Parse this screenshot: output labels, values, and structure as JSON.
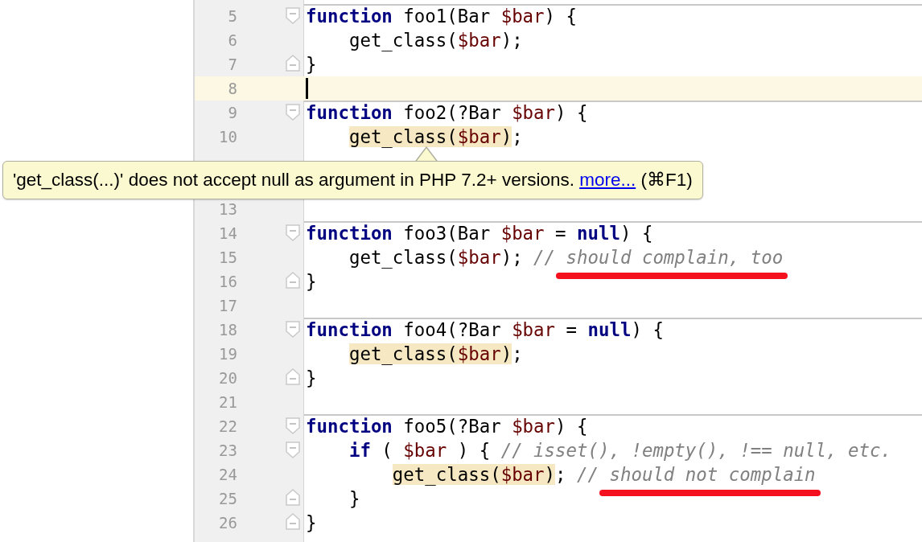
{
  "editor": {
    "lines": [
      {
        "kind": "code",
        "number": "5",
        "fold_open": true,
        "separator": true,
        "tokens": [
          {
            "kind": "keyword",
            "text": "function"
          },
          {
            "kind": "plain",
            "text": " foo1(Bar "
          },
          {
            "kind": "variable",
            "text": "$bar"
          },
          {
            "kind": "plain",
            "text": ") {"
          }
        ]
      },
      {
        "kind": "code",
        "number": "6",
        "tokens": [
          {
            "kind": "plain",
            "text": "    get_class("
          },
          {
            "kind": "variable",
            "text": "$bar"
          },
          {
            "kind": "plain",
            "text": ");"
          }
        ]
      },
      {
        "kind": "code",
        "number": "7",
        "fold_close": true,
        "tokens": [
          {
            "kind": "plain",
            "text": "}"
          }
        ]
      },
      {
        "kind": "code",
        "number": "8",
        "current": true
      },
      {
        "kind": "code",
        "number": "9",
        "fold_open": true,
        "separator": true,
        "tokens": [
          {
            "kind": "keyword",
            "text": "function"
          },
          {
            "kind": "plain",
            "text": " foo2(?Bar "
          },
          {
            "kind": "variable",
            "text": "$bar"
          },
          {
            "kind": "plain",
            "text": ") {"
          }
        ]
      },
      {
        "kind": "code",
        "number": "10",
        "tokens": [
          {
            "kind": "indent"
          },
          {
            "kind": "warning",
            "tokens": [
              {
                "kind": "plain",
                "text": "get_class("
              },
              {
                "kind": "variable",
                "text": "$bar"
              },
              {
                "kind": "plain",
                "text": ")"
              }
            ]
          },
          {
            "kind": "plain",
            "text": ";"
          }
        ]
      },
      {
        "kind": "covered"
      },
      {
        "kind": "covered"
      },
      {
        "kind": "code",
        "number": "13"
      },
      {
        "kind": "code",
        "number": "14",
        "fold_open": true,
        "separator": true,
        "tokens": [
          {
            "kind": "keyword",
            "text": "function"
          },
          {
            "kind": "plain",
            "text": " foo3(Bar "
          },
          {
            "kind": "variable",
            "text": "$bar"
          },
          {
            "kind": "plain",
            "text": " = "
          },
          {
            "kind": "keyword",
            "text": "null"
          },
          {
            "kind": "plain",
            "text": ") {"
          }
        ]
      },
      {
        "kind": "code",
        "number": "15",
        "tokens": [
          {
            "kind": "plain",
            "text": "    get_class("
          },
          {
            "kind": "variable",
            "text": "$bar"
          },
          {
            "kind": "plain",
            "text": "); "
          },
          {
            "kind": "comment",
            "text": "// should complain, too",
            "underlined": true
          }
        ]
      },
      {
        "kind": "code",
        "number": "16",
        "fold_close": true,
        "tokens": [
          {
            "kind": "plain",
            "text": "}"
          }
        ]
      },
      {
        "kind": "code",
        "number": "17"
      },
      {
        "kind": "code",
        "number": "18",
        "fold_open": true,
        "separator": true,
        "tokens": [
          {
            "kind": "keyword",
            "text": "function"
          },
          {
            "kind": "plain",
            "text": " foo4(?Bar "
          },
          {
            "kind": "variable",
            "text": "$bar"
          },
          {
            "kind": "plain",
            "text": " = "
          },
          {
            "kind": "keyword",
            "text": "null"
          },
          {
            "kind": "plain",
            "text": ") {"
          }
        ]
      },
      {
        "kind": "code",
        "number": "19",
        "tokens": [
          {
            "kind": "indent"
          },
          {
            "kind": "warning",
            "tokens": [
              {
                "kind": "plain",
                "text": "get_class("
              },
              {
                "kind": "variable",
                "text": "$bar"
              },
              {
                "kind": "plain",
                "text": ")"
              }
            ]
          },
          {
            "kind": "plain",
            "text": ";"
          }
        ]
      },
      {
        "kind": "code",
        "number": "20",
        "fold_close": true,
        "tokens": [
          {
            "kind": "plain",
            "text": "}"
          }
        ]
      },
      {
        "kind": "code",
        "number": "21"
      },
      {
        "kind": "code",
        "number": "22",
        "fold_open": true,
        "separator": true,
        "tokens": [
          {
            "kind": "keyword",
            "text": "function"
          },
          {
            "kind": "plain",
            "text": " foo5(?Bar "
          },
          {
            "kind": "variable",
            "text": "$bar"
          },
          {
            "kind": "plain",
            "text": ") {"
          }
        ]
      },
      {
        "kind": "code",
        "number": "23",
        "fold_open": true,
        "tokens": [
          {
            "kind": "indent"
          },
          {
            "kind": "keyword",
            "text": "if"
          },
          {
            "kind": "plain",
            "text": " ( "
          },
          {
            "kind": "variable",
            "text": "$bar"
          },
          {
            "kind": "plain",
            "text": " ) { "
          },
          {
            "kind": "comment",
            "text": "// isset(), !empty(), !== null, etc."
          }
        ]
      },
      {
        "kind": "code",
        "number": "24",
        "tokens": [
          {
            "kind": "indent"
          },
          {
            "kind": "indent"
          },
          {
            "kind": "warning",
            "tokens": [
              {
                "kind": "plain",
                "text": "get_class("
              },
              {
                "kind": "variable",
                "text": "$bar"
              },
              {
                "kind": "plain",
                "text": ")"
              }
            ]
          },
          {
            "kind": "plain",
            "text": "; "
          },
          {
            "kind": "comment",
            "text": "// should not complain",
            "underlined": true
          }
        ]
      },
      {
        "kind": "code",
        "number": "25",
        "fold_close": true,
        "tokens": [
          {
            "kind": "plain",
            "text": "    }"
          }
        ]
      },
      {
        "kind": "code",
        "number": "26",
        "fold_close": true,
        "tokens": [
          {
            "kind": "plain",
            "text": "}"
          }
        ]
      }
    ]
  },
  "tooltip": {
    "message": "'get_class(...)' does not accept null as argument in PHP 7.2+ versions.",
    "link": "more...",
    "shortcut": "(⌘F1)"
  }
}
